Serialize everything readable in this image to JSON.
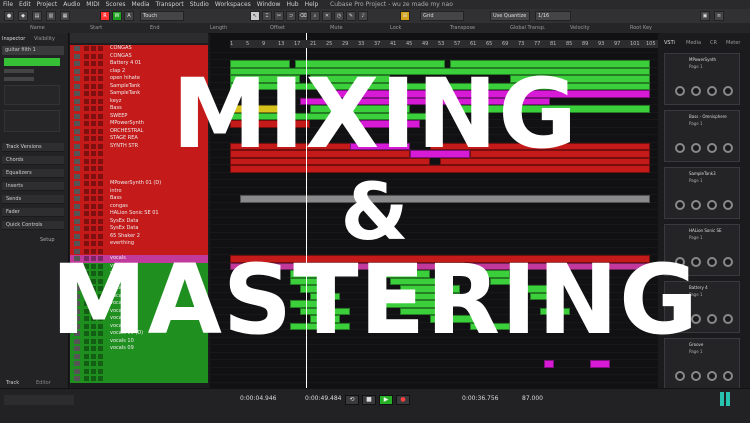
{
  "menu": [
    "File",
    "Edit",
    "Project",
    "Audio",
    "MIDI",
    "Scores",
    "Media",
    "Transport",
    "Studio",
    "Workspaces",
    "Window",
    "Hub",
    "Help"
  ],
  "window_title": "Cubase Pro Project - wu ze made my nao",
  "toolbar": {
    "mode": "Touch",
    "grid": "Grid",
    "quantize": "Use Quantize",
    "quantize_value": "1/16",
    "rec_r": "R",
    "rec_w": "W",
    "rec_a": "A"
  },
  "infoline": [
    "Name",
    "Start",
    "End",
    "Length",
    "Offset",
    "Mute",
    "Lock",
    "Transpose",
    "Global Transp.",
    "Velocity",
    "Root Key"
  ],
  "inspector": {
    "tabs": [
      "Inspector",
      "Visibility"
    ],
    "track_name": "guitar filth 1",
    "sections": [
      "Track Versions",
      "Chords",
      "Equalizers",
      "Inserts",
      "Sends",
      "Fader",
      "Quick Controls"
    ],
    "bottom_tabs": [
      "Track",
      "Editor"
    ],
    "setup": "Setup"
  },
  "tracks": [
    {
      "name": "CONGAS",
      "color": "#c41a1a"
    },
    {
      "name": "CONGAS",
      "color": "#c41a1a"
    },
    {
      "name": "Battery 4 01",
      "color": "#c41a1a"
    },
    {
      "name": "clap 2",
      "color": "#c41a1a"
    },
    {
      "name": "open hihate",
      "color": "#c41a1a"
    },
    {
      "name": "SampleTank",
      "color": "#c41a1a"
    },
    {
      "name": "SampleTank",
      "color": "#c41a1a"
    },
    {
      "name": "keyz",
      "color": "#c41a1a"
    },
    {
      "name": "Bass",
      "color": "#c41a1a"
    },
    {
      "name": "SWEEP",
      "color": "#c41a1a"
    },
    {
      "name": "MPowerSynth",
      "color": "#c41a1a"
    },
    {
      "name": "ORCHESTRAL",
      "color": "#c41a1a"
    },
    {
      "name": "STAGE REA",
      "color": "#c41a1a"
    },
    {
      "name": "SYNTH STR",
      "color": "#c41a1a"
    },
    {
      "name": "",
      "color": "#c41a1a"
    },
    {
      "name": "",
      "color": "#c41a1a"
    },
    {
      "name": "",
      "color": "#c41a1a"
    },
    {
      "name": "",
      "color": "#c41a1a"
    },
    {
      "name": "MPowerSynth 01 (D)",
      "color": "#c41a1a"
    },
    {
      "name": "intro",
      "color": "#c41a1a"
    },
    {
      "name": "Bass",
      "color": "#c41a1a"
    },
    {
      "name": "congas",
      "color": "#c41a1a"
    },
    {
      "name": "HALion Sonic SE 01",
      "color": "#c41a1a"
    },
    {
      "name": "SysEx Data",
      "color": "#c41a1a"
    },
    {
      "name": "SysEx Data",
      "color": "#c41a1a"
    },
    {
      "name": "65 Shaker 2",
      "color": "#c41a1a"
    },
    {
      "name": "everthing",
      "color": "#c41a1a"
    },
    {
      "name": "",
      "color": "#c41a1a"
    },
    {
      "name": "vocals",
      "color": "#c0399b"
    },
    {
      "name": "vocals",
      "color": "#1f8f1f"
    },
    {
      "name": "vocals",
      "color": "#1f8f1f"
    },
    {
      "name": "vocals",
      "color": "#1f8f1f"
    },
    {
      "name": "vocals",
      "color": "#1f8f1f"
    },
    {
      "name": "vocals",
      "color": "#1f8f1f"
    },
    {
      "name": "vocals 05",
      "color": "#1f8f1f"
    },
    {
      "name": "vocals 06",
      "color": "#1f8f1f"
    },
    {
      "name": "vocals 07",
      "color": "#1f8f1f"
    },
    {
      "name": "vocals 08",
      "color": "#1f8f1f"
    },
    {
      "name": "vocals 09 (D)",
      "color": "#1f8f1f"
    },
    {
      "name": "vocals 10",
      "color": "#1f8f1f"
    },
    {
      "name": "vocals 09",
      "color": "#1f8f1f"
    },
    {
      "name": "",
      "color": "#1f8f1f"
    },
    {
      "name": "",
      "color": "#1f8f1f"
    },
    {
      "name": "",
      "color": "#1f8f1f"
    },
    {
      "name": "",
      "color": "#1f8f1f"
    }
  ],
  "ruler_marks": [
    "1",
    "5",
    "9",
    "13",
    "17",
    "21",
    "25",
    "29",
    "33",
    "37",
    "41",
    "45",
    "49",
    "53",
    "57",
    "61",
    "65",
    "69",
    "73",
    "77",
    "81",
    "85",
    "89",
    "93",
    "97",
    "101",
    "105"
  ],
  "right_zone": {
    "tabs": [
      "VSTi",
      "Media",
      "CR",
      "Meter"
    ],
    "slots": [
      {
        "name": "MPowerSynth",
        "page": "Page 1"
      },
      {
        "name": "Bass - Omnisphere",
        "page": "Page 1"
      },
      {
        "name": "SampleTank3",
        "page": "Page 1"
      },
      {
        "name": "HALion Sonic SE",
        "page": "Page 1"
      },
      {
        "name": "Battery 4",
        "page": "Page 1"
      },
      {
        "name": "Groove",
        "page": "Page 1"
      }
    ]
  },
  "transport": {
    "left_locator": "0:00:04.946",
    "right_locator": "0:00:49.484",
    "position": "0:00:36.756",
    "tempo": "87.000"
  },
  "overlay": {
    "line1": "MIXING",
    "line2": "&",
    "line3": "MASTERING"
  },
  "colors": {
    "red_track": "#c41a1a",
    "green_track": "#1f8f1f",
    "pink_track": "#c0399b",
    "clip_green": "#3ccf3c",
    "clip_magenta": "#d61ad6",
    "clip_yellow": "#d6c21a"
  }
}
